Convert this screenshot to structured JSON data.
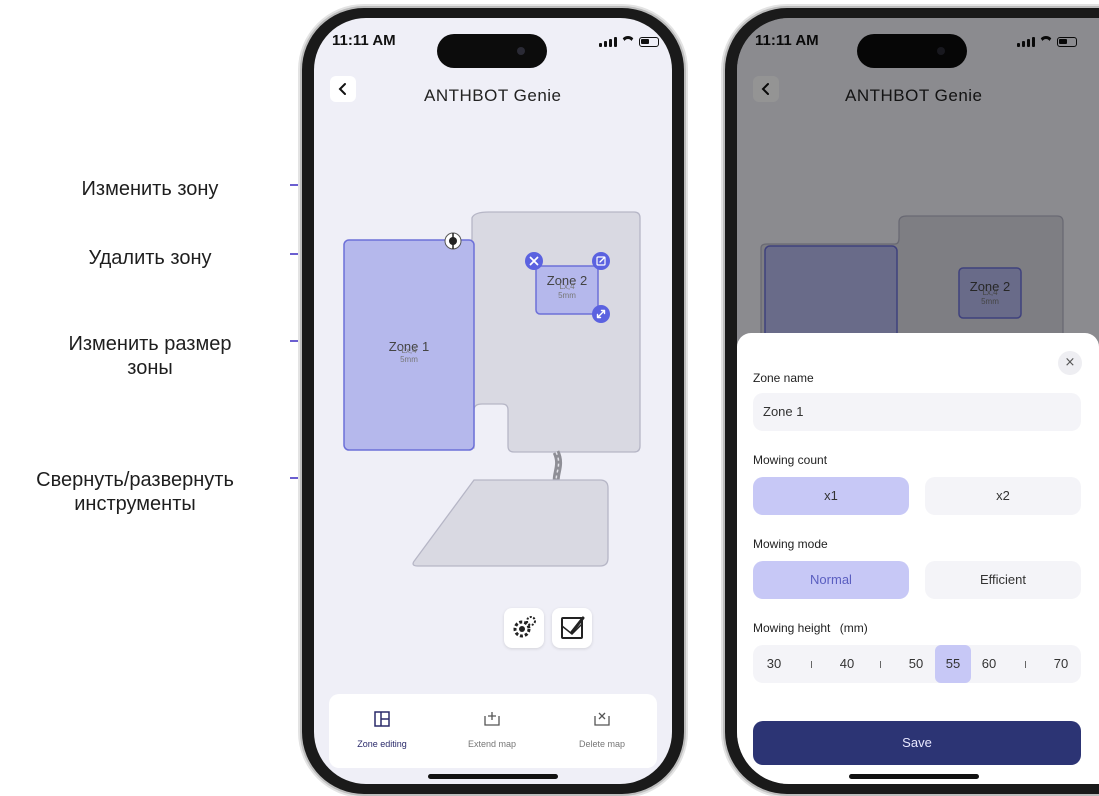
{
  "annotations": {
    "edit_zone": "Изменить зону",
    "delete_zone": "Удалить зону",
    "resize_zone_line1": "Изменить размер",
    "resize_zone_line2": "зоны",
    "toggle_tools_line1": "Свернуть/развернуть",
    "toggle_tools_line2": "инструменты"
  },
  "status_bar": {
    "time": "11:11 AM"
  },
  "header": {
    "title": "ANTHBOT Genie"
  },
  "map": {
    "zone1": {
      "name": "Zone 1",
      "sub": "Lx,4",
      "height": "5mm"
    },
    "zone2": {
      "name": "Zone 2",
      "sub": "Lx,4",
      "height": "5mm"
    }
  },
  "bottom_tabs": [
    {
      "label": "Zone editing",
      "icon": "zone-editing-icon",
      "active": true
    },
    {
      "label": "Extend map",
      "icon": "extend-map-icon",
      "active": false
    },
    {
      "label": "Delete map",
      "icon": "delete-map-icon",
      "active": false
    }
  ],
  "sheet": {
    "close": "×",
    "zone_name_label": "Zone name",
    "zone_name_value": "Zone 1",
    "mowing_count_label": "Mowing count",
    "mowing_count_options": [
      "x1",
      "x2"
    ],
    "mowing_count_selected": "x1",
    "mowing_mode_label": "Mowing mode",
    "mowing_mode_options": [
      "Normal",
      "Efficient"
    ],
    "mowing_mode_selected": "Normal",
    "mowing_height_label": "Mowing height",
    "mowing_height_unit": "(mm)",
    "mowing_height_values": [
      "30",
      "40",
      "50",
      "55",
      "60",
      "70"
    ],
    "mowing_height_selected": "55",
    "save_label": "Save"
  },
  "colors": {
    "accent": "#5b62e0",
    "zone_fill": "#b5b8ec",
    "map_fill": "#d9d9e2",
    "annotation_line": "#6b5fd0",
    "save_button": "#2c3474"
  }
}
